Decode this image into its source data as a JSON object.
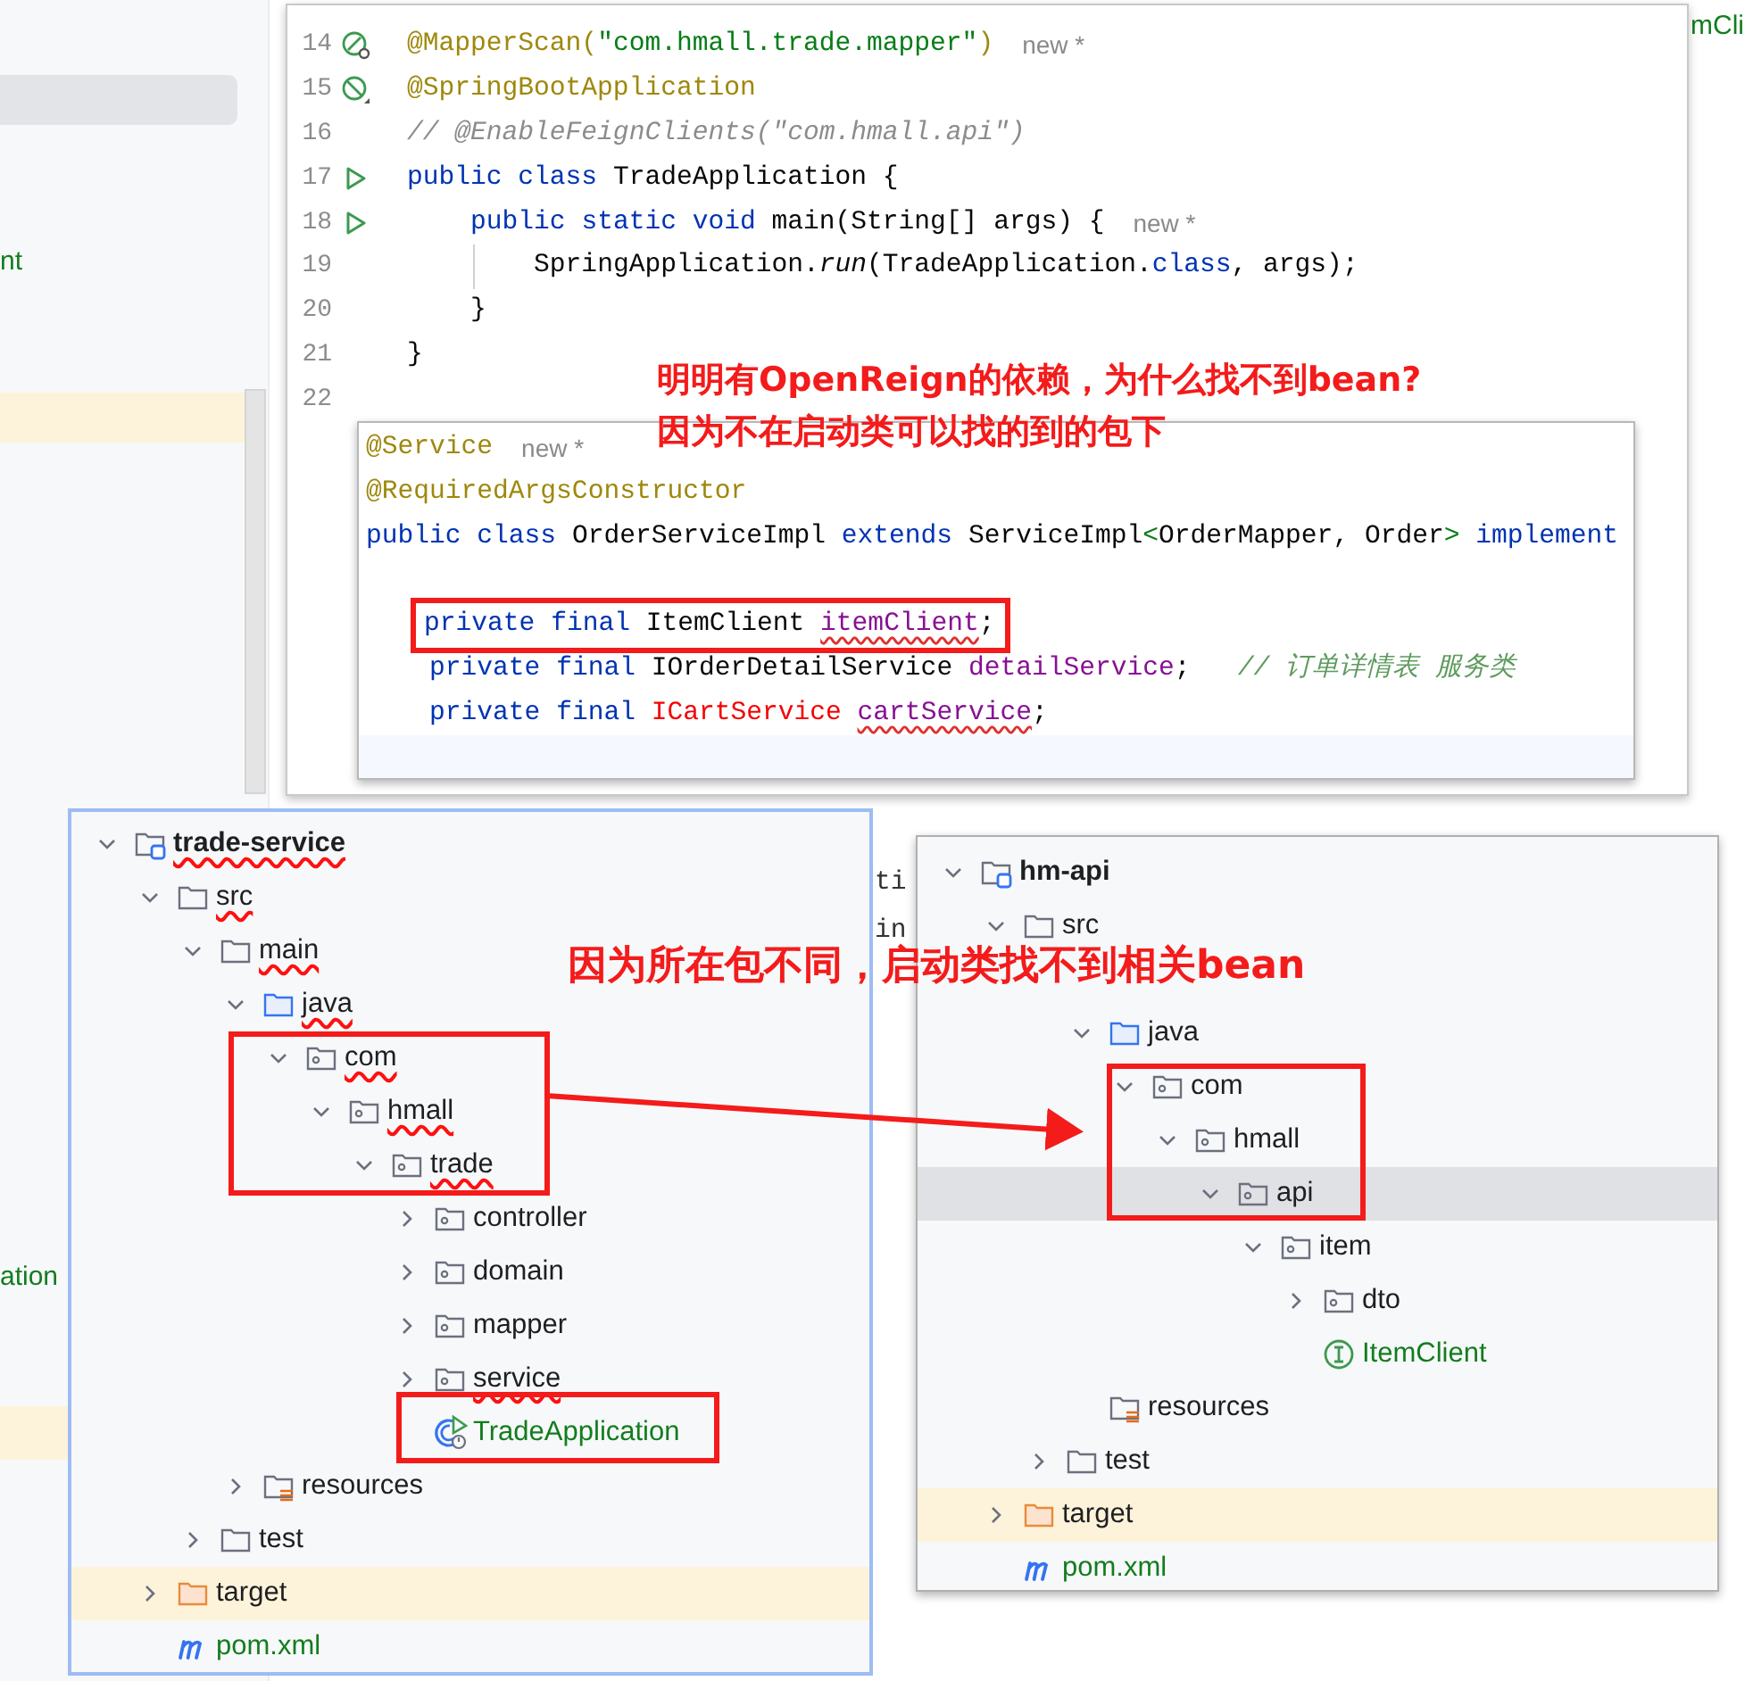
{
  "background": {
    "fragments": [
      {
        "text": "nt",
        "kind": "green"
      },
      {
        "text": "ation",
        "kind": "green"
      },
      {
        "text": "mCli",
        "kind": "green"
      },
      {
        "text": "ti",
        "kind": "code"
      },
      {
        "text": "in",
        "kind": "code"
      }
    ]
  },
  "main_editor": {
    "lines": [
      {
        "number": "14",
        "gutter": {
          "kind": "bean-search"
        },
        "tokens": [
          {
            "text": "@MapperScan(",
            "kind": "ann"
          },
          {
            "text": "\"com.hmall.trade.mapper\"",
            "kind": "str"
          },
          {
            "text": ")",
            "kind": "ann"
          }
        ],
        "hint": "new *"
      },
      {
        "number": "15",
        "gutter": {
          "kind": "bean-disabled"
        },
        "tokens": [
          {
            "text": "@SpringBootApplication",
            "kind": "ann"
          }
        ]
      },
      {
        "number": "16",
        "tokens": [
          {
            "text": "// @EnableFeignClients(\"com.hmall.api\")",
            "kind": "comment"
          }
        ]
      },
      {
        "number": "17",
        "gutter": {
          "kind": "run"
        },
        "tokens": [
          {
            "text": "public class ",
            "kind": "kw"
          },
          {
            "text": "TradeApplication {",
            "kind": "plain"
          }
        ]
      },
      {
        "number": "18",
        "gutter": {
          "kind": "run"
        },
        "tokens": [
          {
            "text": "    public static void ",
            "kind": "kw"
          },
          {
            "text": "main(String[] args) {",
            "kind": "plain"
          }
        ],
        "hint": "new *"
      },
      {
        "number": "19",
        "tokens": [
          {
            "text": "        SpringApplication.",
            "kind": "plain"
          },
          {
            "text": "run",
            "kind": "italic"
          },
          {
            "text": "(TradeApplication.",
            "kind": "plain"
          },
          {
            "text": "class",
            "kind": "kw"
          },
          {
            "text": ", args);",
            "kind": "plain"
          }
        ]
      },
      {
        "number": "20",
        "tokens": [
          {
            "text": "    }",
            "kind": "plain"
          }
        ]
      },
      {
        "number": "21",
        "tokens": [
          {
            "text": "}",
            "kind": "plain"
          }
        ]
      },
      {
        "number": "22"
      }
    ]
  },
  "service_editor": {
    "lines": [
      {
        "tokens": [
          {
            "text": "@Service",
            "kind": "ann"
          }
        ],
        "hint": "new *"
      },
      {
        "tokens": [
          {
            "text": "@RequiredArgsConstructor",
            "kind": "ann"
          }
        ]
      },
      {
        "tokens": [
          {
            "text": "public class ",
            "kind": "kw"
          },
          {
            "text": "OrderServiceImpl ",
            "kind": "plain"
          },
          {
            "text": "extends ",
            "kind": "kw"
          },
          {
            "text": "ServiceImpl",
            "kind": "plain"
          },
          {
            "text": "<",
            "kind": "str"
          },
          {
            "text": "OrderMapper, Order",
            "kind": "plain"
          },
          {
            "text": "> ",
            "kind": "str"
          },
          {
            "text": "implement",
            "kind": "kw"
          }
        ]
      },
      {
        "tokens": [
          {
            "text": "    private final ",
            "kind": "kw"
          },
          {
            "text": "ItemClient ",
            "kind": "plain"
          },
          {
            "text": "itemClient",
            "kind": "field-err"
          },
          {
            "text": ";",
            "kind": "plain"
          }
        ]
      },
      {
        "tokens": [
          {
            "text": "    private final ",
            "kind": "kw"
          },
          {
            "text": "IOrderDetailService ",
            "kind": "plain"
          },
          {
            "text": "detailService",
            "kind": "field"
          },
          {
            "text": ";   ",
            "kind": "plain"
          },
          {
            "text": "// 订单详情表 服务类",
            "kind": "doc"
          }
        ]
      },
      {
        "tokens": [
          {
            "text": "    private final ",
            "kind": "kw"
          },
          {
            "text": "ICartService ",
            "kind": "type-err"
          },
          {
            "text": "cartService",
            "kind": "field-err"
          },
          {
            "text": ";",
            "kind": "plain"
          }
        ]
      }
    ]
  },
  "annotations": [
    "明明有OpenReign的依赖，为什么找不到bean?",
    "因为不在启动类可以找的到的包下",
    "因为所在包不同，启动类找不到相关bean"
  ],
  "project_trees": [
    {
      "nodes": [
        {
          "label": "trade-service",
          "kind": "module",
          "expanded": true,
          "selected": false,
          "error": true,
          "children": [
            {
              "label": "src",
              "kind": "folder",
              "expanded": true,
              "selected": false,
              "error": true,
              "children": [
                {
                  "label": "main",
                  "kind": "folder",
                  "expanded": true,
                  "selected": false,
                  "error": true,
                  "children": [
                    {
                      "label": "java",
                      "kind": "source",
                      "expanded": true,
                      "selected": false,
                      "error": true,
                      "children": [
                        {
                          "label": "com",
                          "kind": "package",
                          "expanded": true,
                          "selected": false,
                          "error": true,
                          "children": [
                            {
                              "label": "hmall",
                              "kind": "package",
                              "expanded": true,
                              "selected": false,
                              "error": true,
                              "children": [
                                {
                                  "label": "trade",
                                  "kind": "package",
                                  "expanded": true,
                                  "selected": false,
                                  "error": true,
                                  "children": [
                                    {
                                      "label": "controller",
                                      "kind": "package",
                                      "expanded": false,
                                      "selected": false,
                                      "error": false
                                    },
                                    {
                                      "label": "domain",
                                      "kind": "package",
                                      "expanded": false,
                                      "selected": false,
                                      "error": false
                                    },
                                    {
                                      "label": "mapper",
                                      "kind": "package",
                                      "expanded": false,
                                      "selected": false,
                                      "error": false
                                    },
                                    {
                                      "label": "service",
                                      "kind": "package",
                                      "expanded": false,
                                      "selected": false,
                                      "error": true
                                    },
                                    {
                                      "label": "TradeApplication",
                                      "kind": "spring-app",
                                      "selected": false,
                                      "error": false
                                    }
                                  ]
                                }
                              ]
                            }
                          ]
                        }
                      ]
                    },
                    {
                      "label": "resources",
                      "kind": "resources",
                      "expanded": false,
                      "selected": false,
                      "error": false
                    }
                  ]
                },
                {
                  "label": "test",
                  "kind": "folder",
                  "expanded": false,
                  "selected": false,
                  "error": false
                }
              ]
            },
            {
              "label": "target",
              "kind": "excluded",
              "expanded": false,
              "selected": false,
              "error": false
            },
            {
              "label": "pom.xml",
              "kind": "maven",
              "selected": false,
              "error": false
            }
          ]
        }
      ]
    },
    {
      "nodes": [
        {
          "label": "hm-api",
          "kind": "module",
          "expanded": true,
          "selected": false,
          "error": false,
          "children": [
            {
              "label": "src",
              "kind": "folder",
              "expanded": true,
              "selected": false,
              "error": false,
              "children": [
                {
                  "kind": "folder",
                  "selected": false,
                  "children": [
                    {
                      "label": "java",
                      "kind": "source",
                      "expanded": true,
                      "selected": false,
                      "error": false,
                      "children": [
                        {
                          "label": "com",
                          "kind": "package",
                          "expanded": true,
                          "selected": false,
                          "error": false,
                          "children": [
                            {
                              "label": "hmall",
                              "kind": "package",
                              "expanded": true,
                              "selected": false,
                              "error": false,
                              "children": [
                                {
                                  "label": "api",
                                  "kind": "package",
                                  "expanded": true,
                                  "selected": true,
                                  "error": false,
                                  "children": [
                                    {
                                      "label": "item",
                                      "kind": "package",
                                      "expanded": true,
                                      "selected": false,
                                      "error": false,
                                      "children": [
                                        {
                                          "label": "dto",
                                          "kind": "package",
                                          "expanded": false,
                                          "selected": false,
                                          "error": false
                                        },
                                        {
                                          "label": "ItemClient",
                                          "kind": "interface",
                                          "selected": false,
                                          "error": false
                                        }
                                      ]
                                    }
                                  ]
                                }
                              ]
                            }
                          ]
                        }
                      ]
                    },
                    {
                      "label": "resources",
                      "kind": "resources",
                      "selected": false,
                      "error": false
                    }
                  ]
                },
                {
                  "label": "test",
                  "kind": "folder",
                  "expanded": false,
                  "selected": false,
                  "error": false
                }
              ]
            },
            {
              "label": "target",
              "kind": "excluded",
              "expanded": false,
              "selected": false,
              "error": false
            },
            {
              "label": "pom.xml",
              "kind": "maven",
              "selected": false,
              "error": false
            }
          ]
        }
      ]
    }
  ]
}
